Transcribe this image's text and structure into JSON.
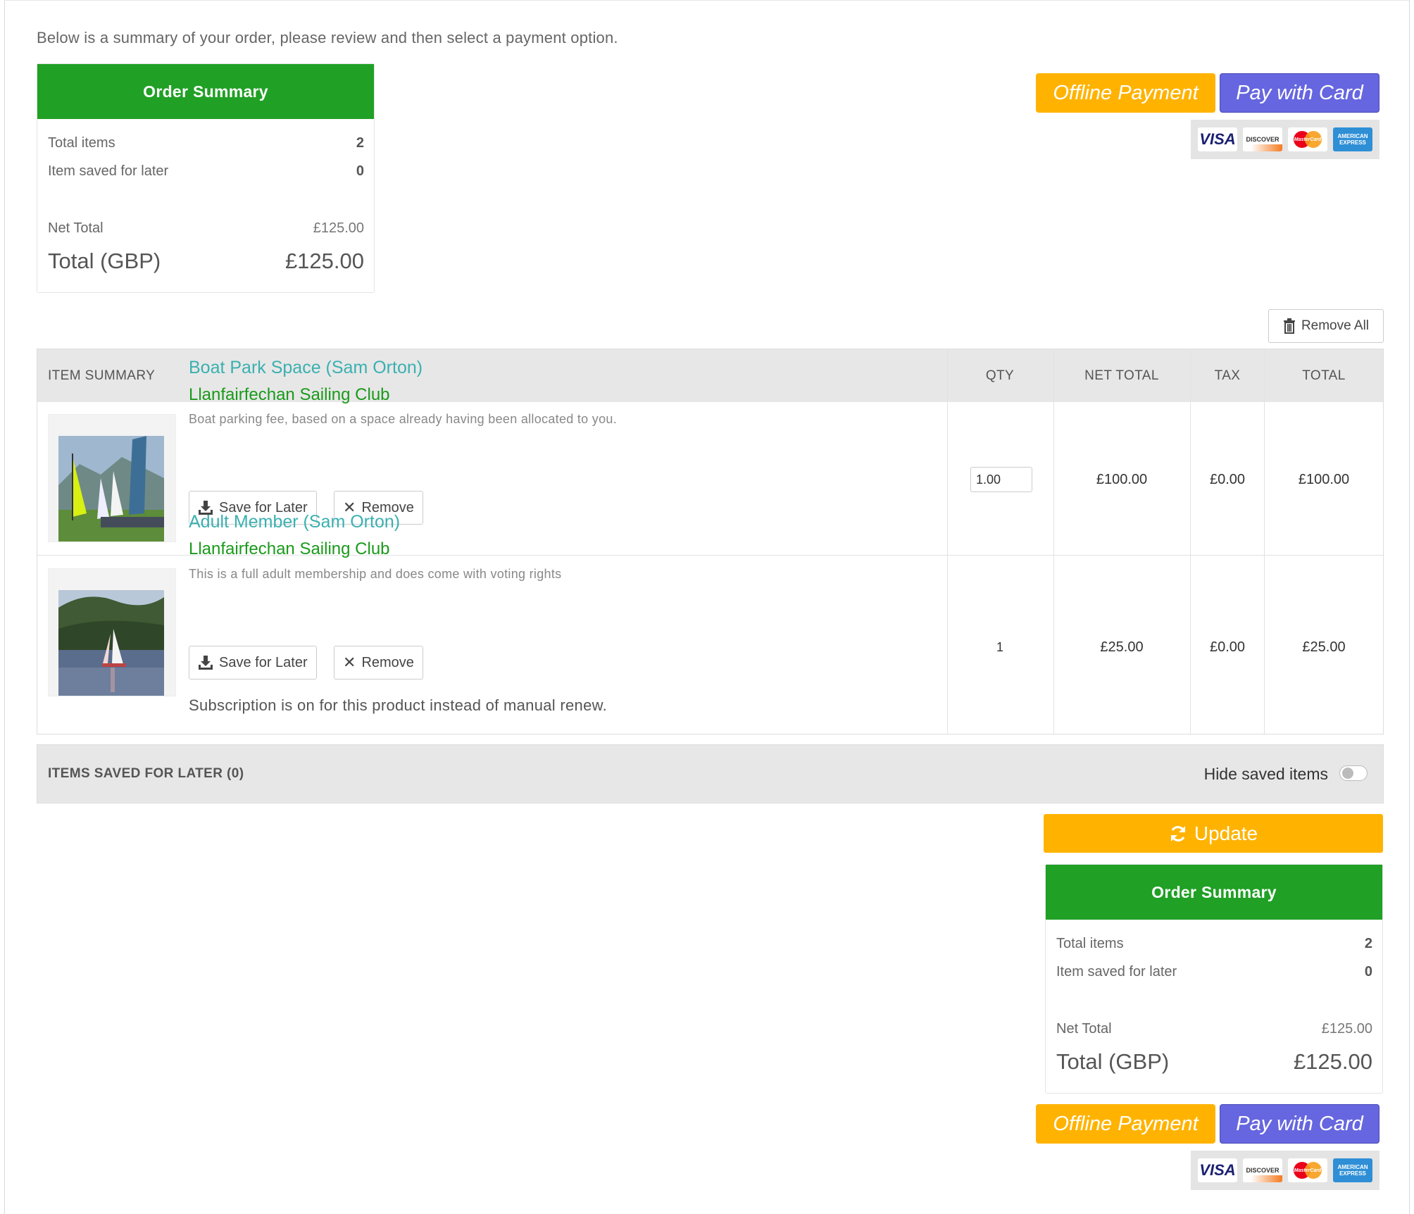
{
  "intro": "Below is a summary of your order, please review and then select a payment option.",
  "summary": {
    "title": "Order Summary",
    "total_items_label": "Total items",
    "total_items_value": "2",
    "saved_label": "Item saved for later",
    "saved_value": "0",
    "net_label": "Net Total",
    "net_value": "£125.00",
    "total_label": "Total (GBP)",
    "total_value": "£125.00"
  },
  "payment": {
    "offline_label": "Offline Payment",
    "card_label": "Pay with Card",
    "cards": [
      {
        "name": "visa-icon",
        "text": "VISA"
      },
      {
        "name": "discover-icon",
        "text": "DISCOVER"
      },
      {
        "name": "mastercard-icon",
        "text": "MasterCard"
      },
      {
        "name": "amex-icon",
        "text": "AMERICAN EXPRESS"
      }
    ]
  },
  "remove_all_label": "Remove All",
  "table": {
    "headers": {
      "item": "ITEM SUMMARY",
      "qty": "QTY",
      "net": "NET TOTAL",
      "tax": "TAX",
      "total": "TOTAL"
    },
    "rows": [
      {
        "name": "Boat Park Space (Sam Orton)",
        "club": "Llanfairfechan Sailing Club",
        "desc": "Boat parking fee, based on a space already having been allocated to you.",
        "qty": "1.00",
        "net": "£100.00",
        "tax": "£0.00",
        "total": "£100.00",
        "save_label": "Save for Later",
        "remove_label": "Remove"
      },
      {
        "name": "Adult Member (Sam Orton)",
        "club": "Llanfairfechan Sailing Club",
        "desc": "This is a full adult membership and does come with voting rights",
        "qty": "1",
        "net": "£25.00",
        "tax": "£0.00",
        "total": "£25.00",
        "save_label": "Save for Later",
        "remove_label": "Remove",
        "note": "Subscription is on for this product instead of manual renew."
      }
    ]
  },
  "saved": {
    "title": "ITEMS SAVED FOR LATER (0)",
    "hide_label": "Hide saved items",
    "hide_enabled": false
  },
  "update_label": "Update",
  "colors": {
    "summary_green": "#20a025",
    "offline_yellow": "#ffb300",
    "card_purple": "#6666e0",
    "product_link": "#3bb0b0",
    "club_green": "#1a9a1a"
  }
}
